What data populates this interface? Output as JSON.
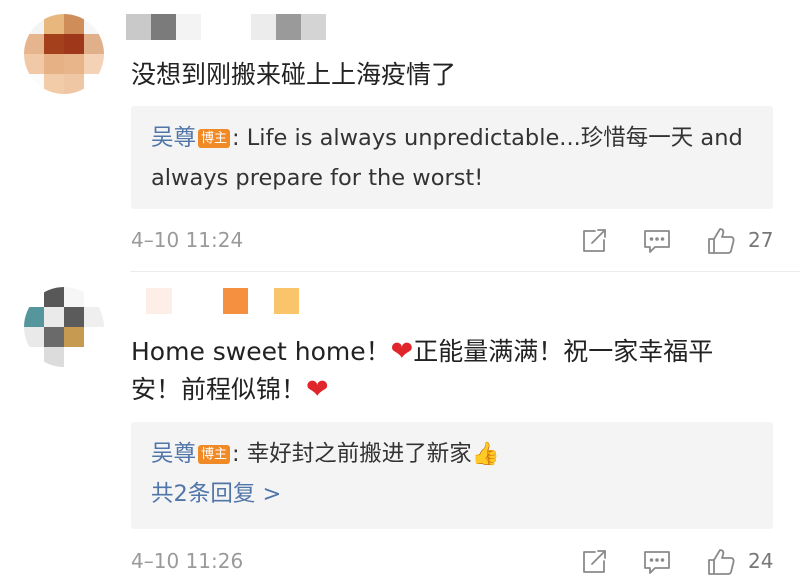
{
  "comments": [
    {
      "text": "没想到刚搬来碰上上海疫情了",
      "reply": {
        "author": "吴尊",
        "badge": "博主",
        "text": ": Life is always unpredictable...珍惜每一天 and always prepare for the worst!"
      },
      "time": "4–10 11:24",
      "likes": "27",
      "icons": [
        "share-icon",
        "reply-icon",
        "thumbs-up-icon"
      ]
    },
    {
      "text_part1": "Home sweet home！",
      "text_part2": "正能量满满！祝一家幸福平安！前程似锦！",
      "heart": "❤",
      "reply": {
        "author": "吴尊",
        "badge": "博主",
        "text": ": 幸好封之前搬进了新家",
        "emoji": "👍",
        "more": "共2条回复 >"
      },
      "time": "4–10 11:26",
      "likes": "24",
      "icons": [
        "share-icon",
        "reply-icon",
        "thumbs-up-icon"
      ]
    }
  ],
  "colors": {
    "author": "#5075a8",
    "badge": "#f08a26",
    "reply_background": "#f4f4f4",
    "heart": "#e0262a",
    "meta_text": "#9a9a9a"
  }
}
